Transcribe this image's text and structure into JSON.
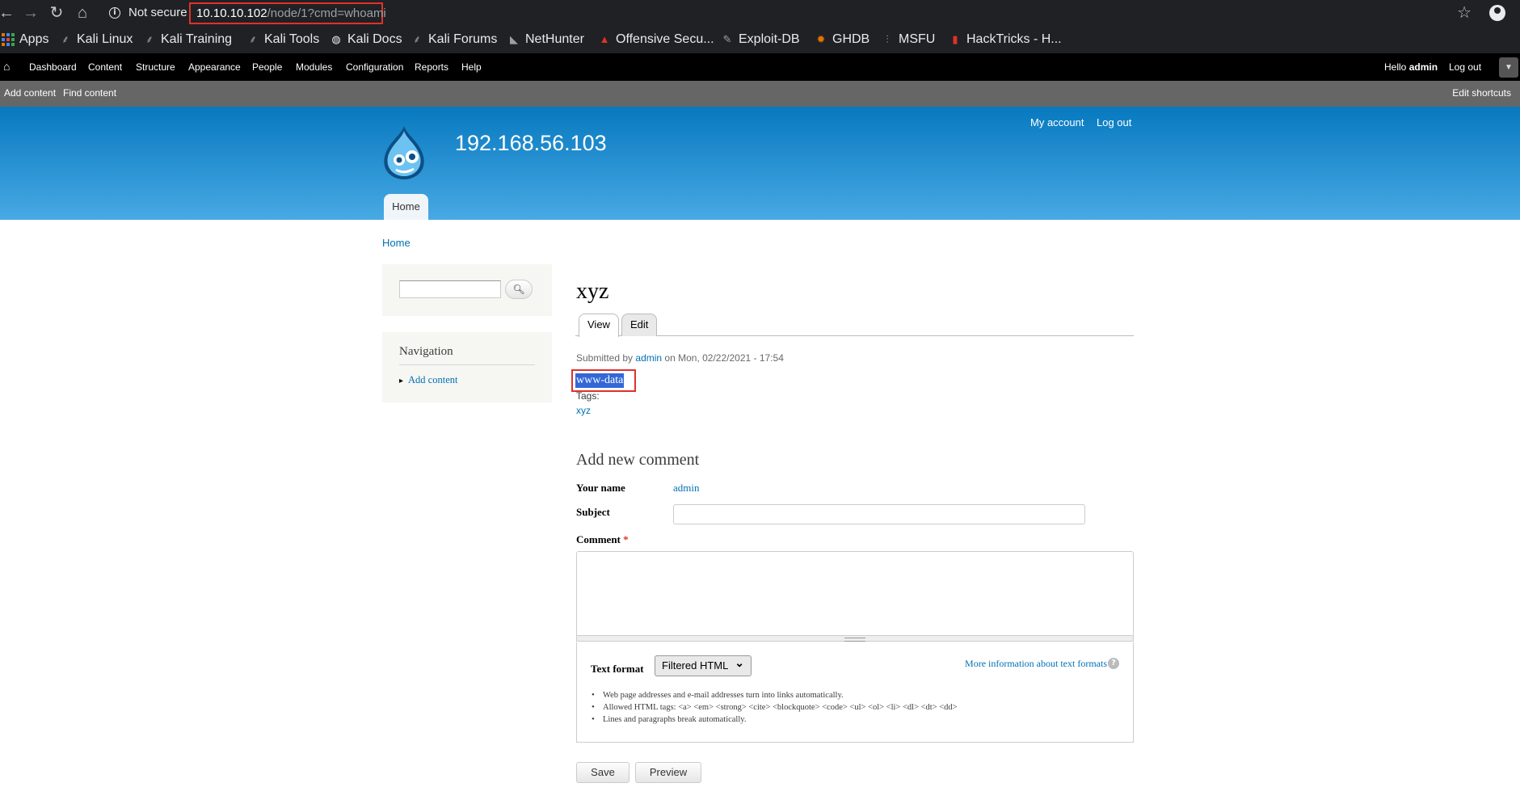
{
  "browser": {
    "security_label": "Not secure",
    "url_host": "10.10.10.102",
    "url_path": "/node/1?cmd=whoami",
    "bookmarks": [
      "Apps",
      "Kali Linux",
      "Kali Training",
      "Kali Tools",
      "Kali Docs",
      "Kali Forums",
      "NetHunter",
      "Offensive Secu...",
      "Exploit-DB",
      "GHDB",
      "MSFU",
      "HackTricks - H..."
    ]
  },
  "admin_toolbar": {
    "items": [
      "Dashboard",
      "Content",
      "Structure",
      "Appearance",
      "People",
      "Modules",
      "Configuration",
      "Reports",
      "Help"
    ],
    "hello_prefix": "Hello",
    "user": "admin",
    "logout": "Log out"
  },
  "shortcuts": {
    "add_content": "Add content",
    "find_content": "Find content",
    "edit_shortcuts": "Edit shortcuts"
  },
  "header": {
    "site_name": "192.168.56.103",
    "my_account": "My account",
    "log_out": "Log out",
    "home_tab": "Home"
  },
  "breadcrumb": "Home",
  "sidebar": {
    "navigation_title": "Navigation",
    "nav_item": "Add content"
  },
  "node": {
    "title": "xyz",
    "tabs": [
      "View",
      "Edit"
    ],
    "submitted_prefix": "Submitted by",
    "author": "admin",
    "date_text": "on Mon, 02/22/2021 - 17:54",
    "body": "www-data",
    "tags_label": "Tags:",
    "tag": "xyz"
  },
  "comment_form": {
    "title": "Add new comment",
    "your_name_label": "Your name",
    "your_name_value": "admin",
    "subject_label": "Subject",
    "comment_label": "Comment",
    "required_mark": "*",
    "text_format_label": "Text format",
    "text_format_value": "Filtered HTML",
    "more_info": "More information about text formats",
    "tips": [
      "Web page addresses and e-mail addresses turn into links automatically.",
      "Allowed HTML tags: <a> <em> <strong> <cite> <blockquote> <code> <ul> <ol> <li> <dl> <dt> <dd>",
      "Lines and paragraphs break automatically."
    ],
    "save": "Save",
    "preview": "Preview"
  },
  "colors": {
    "header_top": "#0779bf",
    "link": "#0071b3",
    "highlight_box": "#e0312a",
    "selection": "#3367d6"
  }
}
